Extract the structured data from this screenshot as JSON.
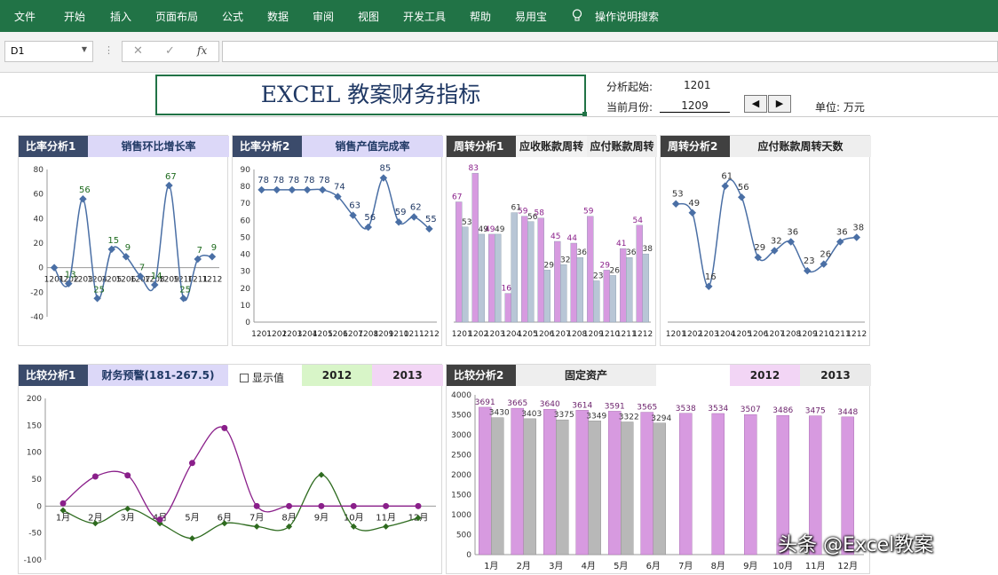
{
  "ribbon": {
    "tabs": [
      "文件",
      "开始",
      "插入",
      "页面布局",
      "公式",
      "数据",
      "审阅",
      "视图",
      "开发工具",
      "帮助",
      "易用宝"
    ],
    "search": "操作说明搜索"
  },
  "formula_bar": {
    "name_box": "D1",
    "fx": "fx",
    "cancel": "✕",
    "enter": "✓"
  },
  "sheet": {
    "title": "EXCEL  教案财务指标",
    "start_label": "分析起始:",
    "start_value": "1201",
    "month_label": "当前月份:",
    "month_value": "1209",
    "unit_label": "单位: 万元",
    "spin_left": "◀",
    "spin_right": "▶"
  },
  "panels": {
    "p1": {
      "tag": "比率分析1",
      "title": "销售环比增长率"
    },
    "p2": {
      "tag": "比率分析2",
      "title": "销售产值完成率"
    },
    "p3": {
      "tag": "周转分析1",
      "title_a": "应收账款周转",
      "title_b": "应付账款周转"
    },
    "p4": {
      "tag": "周转分析2",
      "title": "应付账款周转天数"
    },
    "p5": {
      "tag": "比较分析1",
      "title": "财务预警(181-267.5)",
      "checkbox": "显示值",
      "year_a": "2012",
      "year_b": "2013"
    },
    "p6": {
      "tag": "比较分析2",
      "title": "固定资产",
      "year_a": "2012",
      "year_b": "2013"
    }
  },
  "watermark": "头条 @Excel教案",
  "chart_data": [
    {
      "type": "line",
      "title": "销售环比增长率",
      "categories": [
        "1201",
        "1202",
        "1203",
        "1204",
        "1205",
        "1206",
        "1207",
        "1208",
        "1209",
        "1210",
        "1211",
        "1212"
      ],
      "values": [
        0,
        -13,
        56,
        -25,
        15,
        9,
        -7,
        -14,
        67,
        -25,
        7,
        9
      ],
      "labels": [
        "",
        "13",
        "56",
        "25",
        "15",
        "9",
        "7",
        "14",
        "67",
        "25",
        "7",
        "9"
      ],
      "ylim": [
        -40,
        80
      ],
      "yticks": [
        -40,
        -20,
        0,
        20,
        40,
        60,
        80
      ],
      "color": "#4a6fa5",
      "label_color": "#1e6b1e"
    },
    {
      "type": "line",
      "title": "销售产值完成率",
      "categories": [
        "1201",
        "1202",
        "1203",
        "1204",
        "1205",
        "1206",
        "1207",
        "1208",
        "1209",
        "1210",
        "1211",
        "1212"
      ],
      "values": [
        78,
        78,
        78,
        78,
        78,
        74,
        63,
        56,
        85,
        59,
        62,
        55
      ],
      "ylim": [
        0,
        90
      ],
      "yticks": [
        0,
        10,
        20,
        30,
        40,
        50,
        60,
        70,
        80,
        90
      ],
      "color": "#4a6fa5",
      "label_color": "#1f3864"
    },
    {
      "type": "bar",
      "title": "应收账款周转 / 应付账款周转",
      "categories": [
        "1201",
        "1202",
        "1203",
        "1204",
        "1205",
        "1206",
        "1207",
        "1208",
        "1209",
        "1210",
        "1211",
        "1212"
      ],
      "series": [
        {
          "name": "应收账款周转",
          "values": [
            67,
            83,
            49,
            16,
            59,
            58,
            45,
            44,
            59,
            29,
            41,
            54
          ],
          "color": "#d79ae0",
          "label_color": "#8a1f8a"
        },
        {
          "name": "应付账款周转",
          "values": [
            53,
            49,
            49,
            61,
            56,
            29,
            32,
            36,
            23,
            26,
            36,
            38
          ],
          "color": "#b8c6d6",
          "label_color": "#333"
        }
      ],
      "ylim": [
        0,
        90
      ]
    },
    {
      "type": "line",
      "title": "应付账款周转天数",
      "categories": [
        "1201",
        "1202",
        "1203",
        "1204",
        "1205",
        "1206",
        "1207",
        "1208",
        "1209",
        "1210",
        "1211",
        "1212"
      ],
      "values": [
        53,
        49,
        16,
        61,
        56,
        29,
        32,
        36,
        23,
        26,
        36,
        38
      ],
      "ylim": [
        0,
        70
      ],
      "color": "#4a6fa5",
      "label_color": "#333"
    },
    {
      "type": "line",
      "title": "财务预警(181-267.5)",
      "categories": [
        "1月",
        "2月",
        "3月",
        "4月",
        "5月",
        "6月",
        "7月",
        "8月",
        "9月",
        "10月",
        "11月",
        "12月"
      ],
      "series": [
        {
          "name": "2012",
          "values": [
            -8,
            -32,
            -5,
            -32,
            -60,
            -32,
            -38,
            -38,
            58,
            -38,
            -38,
            -22
          ],
          "color": "#2e6b1f"
        },
        {
          "name": "2013",
          "values": [
            5,
            55,
            57,
            -25,
            80,
            145,
            0,
            0,
            0,
            0,
            0,
            0
          ],
          "color": "#8a1f8a"
        }
      ],
      "ylim": [
        -100,
        200
      ],
      "yticks": [
        -100,
        -50,
        0,
        50,
        100,
        150,
        200
      ]
    },
    {
      "type": "bar",
      "title": "固定资产",
      "categories": [
        "1月",
        "2月",
        "3月",
        "4月",
        "5月",
        "6月",
        "7月",
        "8月",
        "9月",
        "10月",
        "11月",
        "12月"
      ],
      "series": [
        {
          "name": "2012",
          "values": [
            3430,
            3403,
            3375,
            3349,
            3322,
            3294,
            null,
            null,
            null,
            null,
            null,
            null
          ],
          "color": "#b8b8b8",
          "label_color": "#333"
        },
        {
          "name": "2013",
          "values": [
            3691,
            3665,
            3640,
            3614,
            3591,
            3565,
            3538,
            3534,
            3507,
            3486,
            3475,
            3448
          ],
          "color": "#d79ae0",
          "label_color": "#6a1f6a"
        }
      ],
      "ylim": [
        0,
        4000
      ],
      "yticks": [
        0,
        500,
        1000,
        1500,
        2000,
        2500,
        3000,
        3500,
        4000
      ]
    }
  ]
}
